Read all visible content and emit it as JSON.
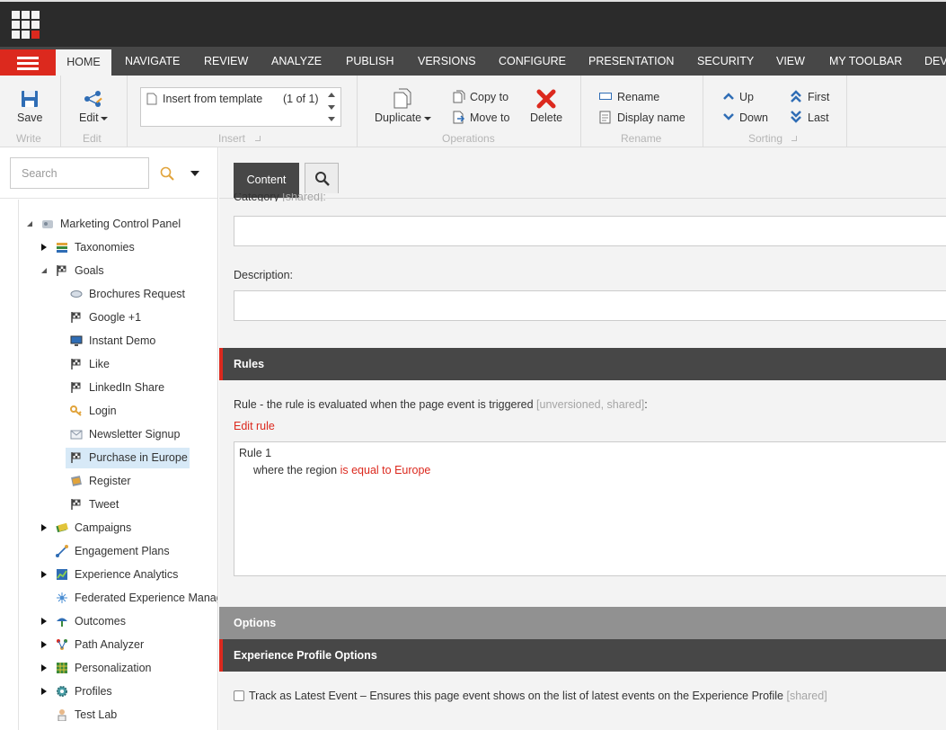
{
  "ribbon_tabs": [
    "HOME",
    "NAVIGATE",
    "REVIEW",
    "ANALYZE",
    "PUBLISH",
    "VERSIONS",
    "CONFIGURE",
    "PRESENTATION",
    "SECURITY",
    "VIEW",
    "MY TOOLBAR",
    "DEV"
  ],
  "ribbon": {
    "write": {
      "save": "Save",
      "group": "Write"
    },
    "edit": {
      "edit": "Edit",
      "group": "Edit"
    },
    "insert": {
      "template": "Insert from template",
      "count": "(1 of 1)",
      "group": "Insert"
    },
    "operations": {
      "duplicate": "Duplicate",
      "copy_to": "Copy to",
      "move_to": "Move to",
      "delete": "Delete",
      "group": "Operations"
    },
    "rename": {
      "rename": "Rename",
      "display_name": "Display name",
      "group": "Rename"
    },
    "sorting": {
      "up": "Up",
      "down": "Down",
      "first": "First",
      "last": "Last",
      "group": "Sorting"
    }
  },
  "sidebar": {
    "search_placeholder": "Search",
    "tree": [
      {
        "label": "Marketing Control Panel"
      },
      {
        "label": "Taxonomies"
      },
      {
        "label": "Goals"
      },
      {
        "label": "Brochures Request"
      },
      {
        "label": "Google +1"
      },
      {
        "label": "Instant Demo"
      },
      {
        "label": "Like"
      },
      {
        "label": "LinkedIn Share"
      },
      {
        "label": "Login"
      },
      {
        "label": "Newsletter Signup"
      },
      {
        "label": "Purchase in Europe"
      },
      {
        "label": "Register"
      },
      {
        "label": "Tweet"
      },
      {
        "label": "Campaigns"
      },
      {
        "label": "Engagement Plans"
      },
      {
        "label": "Experience Analytics"
      },
      {
        "label": "Federated Experience Manager"
      },
      {
        "label": "Outcomes"
      },
      {
        "label": "Path Analyzer"
      },
      {
        "label": "Personalization"
      },
      {
        "label": "Profiles"
      },
      {
        "label": "Test Lab"
      }
    ]
  },
  "content": {
    "tab_label": "Content",
    "category_label": "Category",
    "category_meta": "[shared]:",
    "description_label": "Description:",
    "rules_section": "Rules",
    "rule_label": "Rule - the rule is evaluated when the page event is triggered",
    "rule_meta": "[unversioned, shared]",
    "rule_colon": ":",
    "edit_rule": "Edit rule",
    "rule_title": "Rule 1",
    "rule_where": "where the region",
    "rule_condition": "is equal to Europe",
    "options_section": "Options",
    "profile_section": "Experience Profile Options",
    "track_label": "Track as Latest Event – Ensures this page event shows on the list of latest events on the Experience Profile",
    "track_meta": "[shared]"
  },
  "colors": {
    "accent": "#dc291e",
    "dark": "#2b2b2b",
    "tab_bar": "#474747",
    "selected": "#d7e9f7"
  }
}
